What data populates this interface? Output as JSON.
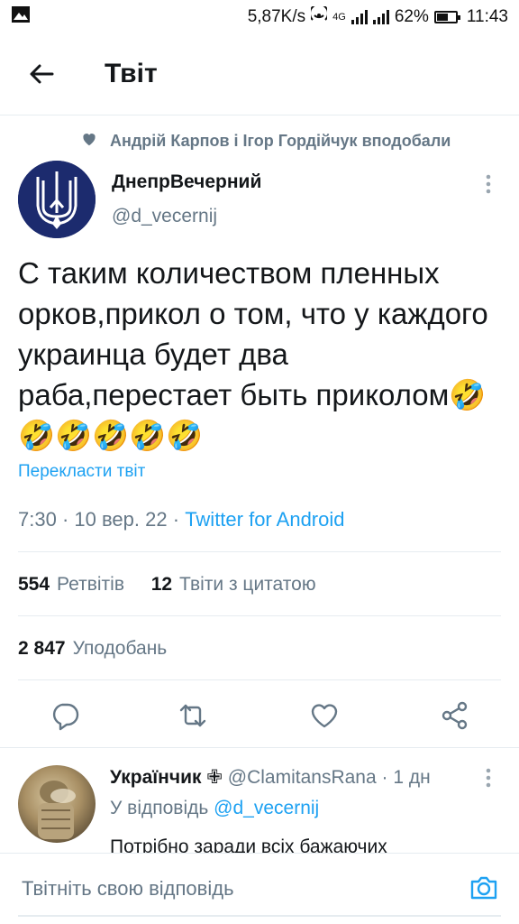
{
  "status_bar": {
    "speed": "5,87K/s",
    "network": "4G",
    "battery_percent": "62%",
    "battery_level": 0.62,
    "time": "11:43"
  },
  "header": {
    "title": "Твіт"
  },
  "social_context": {
    "text": "Андрій Карпов і Ігор Гордійчук вподобали"
  },
  "tweet": {
    "author_name": "ДнепрВечерний",
    "author_handle": "@d_vecernij",
    "text": "С таким количеством пленных орков,прикол о том, что у каждого украинца будет два раба,перестает быть приколом🤣🤣🤣🤣🤣🤣",
    "translate_label": "Перекласти твіт",
    "time": "7:30",
    "date": "10 вер. 22",
    "source": "Twitter for Android"
  },
  "stats": {
    "retweets_count": "554",
    "retweets_label": "Ретвітів",
    "quotes_count": "12",
    "quotes_label": "Твіти з цитатою",
    "likes_count": "2 847",
    "likes_label": "Уподобань"
  },
  "reply": {
    "name": "Українчик ✙",
    "handle": "@ClamitansRana",
    "time": "1 дн",
    "replying_to_prefix": "У відповідь",
    "replying_to_handle": "@d_vecernij",
    "text": "Потрібно заради всіх бажаючих"
  },
  "composer": {
    "placeholder": "Твітніть свою відповідь"
  },
  "colors": {
    "accent": "#1da1f2",
    "secondary_text": "#657786",
    "divider": "#e6ecf0"
  }
}
